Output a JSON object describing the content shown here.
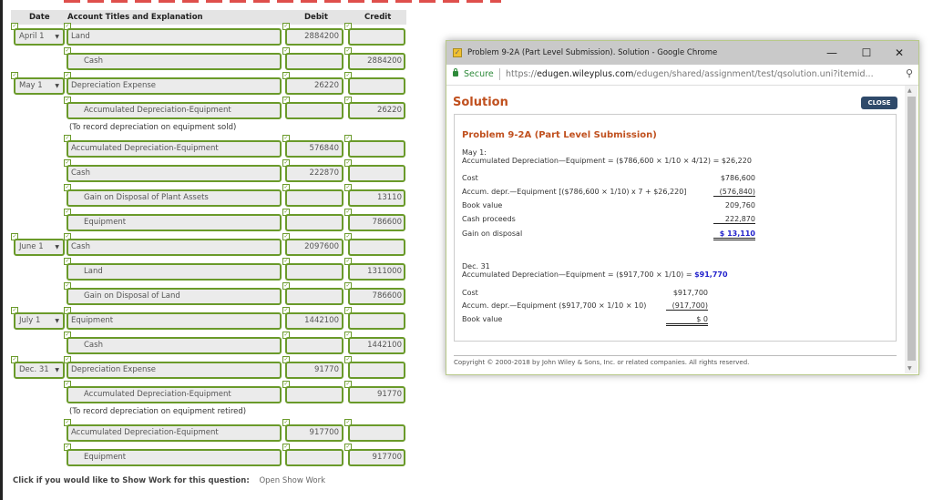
{
  "journal": {
    "headers": {
      "date": "Date",
      "account": "Account Titles and Explanation",
      "debit": "Debit",
      "credit": "Credit"
    },
    "rows": [
      {
        "date": "April 1",
        "account": "Land",
        "indent": false,
        "debit": "2884200",
        "credit": ""
      },
      {
        "date": "",
        "account": "Cash",
        "indent": true,
        "debit": "",
        "credit": "2884200"
      },
      {
        "date": "May 1",
        "account": "Depreciation Expense",
        "indent": false,
        "debit": "26220",
        "credit": ""
      },
      {
        "date": "",
        "account": "Accumulated Depreciation-Equipment",
        "indent": true,
        "debit": "",
        "credit": "26220"
      },
      {
        "explanation": "(To record depreciation on equipment sold)"
      },
      {
        "date": "",
        "account": "Accumulated Depreciation-Equipment",
        "indent": false,
        "debit": "576840",
        "credit": ""
      },
      {
        "date": "",
        "account": "Cash",
        "indent": false,
        "debit": "222870",
        "credit": ""
      },
      {
        "date": "",
        "account": "Gain on Disposal of Plant Assets",
        "indent": true,
        "debit": "",
        "credit": "13110"
      },
      {
        "date": "",
        "account": "Equipment",
        "indent": true,
        "debit": "",
        "credit": "786600"
      },
      {
        "date": "June 1",
        "account": "Cash",
        "indent": false,
        "debit": "2097600",
        "credit": ""
      },
      {
        "date": "",
        "account": "Land",
        "indent": true,
        "debit": "",
        "credit": "1311000"
      },
      {
        "date": "",
        "account": "Gain on Disposal of Land",
        "indent": true,
        "debit": "",
        "credit": "786600"
      },
      {
        "date": "July 1",
        "account": "Equipment",
        "indent": false,
        "debit": "1442100",
        "credit": ""
      },
      {
        "date": "",
        "account": "Cash",
        "indent": true,
        "debit": "",
        "credit": "1442100"
      },
      {
        "date": "Dec. 31",
        "account": "Depreciation Expense",
        "indent": false,
        "debit": "91770",
        "credit": ""
      },
      {
        "date": "",
        "account": "Accumulated Depreciation-Equipment",
        "indent": true,
        "debit": "",
        "credit": "91770"
      },
      {
        "explanation": "(To record depreciation on equipment retired)"
      },
      {
        "date": "",
        "account": "Accumulated Depreciation-Equipment",
        "indent": false,
        "debit": "917700",
        "credit": ""
      },
      {
        "date": "",
        "account": "Equipment",
        "indent": true,
        "debit": "",
        "credit": "917700"
      }
    ],
    "check_glyph": "✓",
    "dropdown_glyph": "▼"
  },
  "show_work": {
    "prompt": "Click if you would like to Show Work for this question:",
    "link": "Open Show Work"
  },
  "popup": {
    "window_title": "Problem 9-2A (Part Level Submission). Solution - Google Chrome",
    "controls": {
      "minimize": "—",
      "maximize": "☐",
      "close": "✕"
    },
    "address_bar": {
      "secure_label": "Secure",
      "url_scheme": "https://",
      "url_domain": "edugen.wileyplus.com",
      "url_path": "/edugen/shared/assignment/test/qsolution.uni?itemid...",
      "zoom_icon": "⚲"
    },
    "heading": "Solution",
    "close_label": "CLOSE",
    "problem_title": "Problem 9-2A (Part Level Submission)",
    "may1": {
      "label": "May 1:",
      "formula": "Accumulated Depreciation—Equipment = ($786,600 × 1/10 × 4/12) = $26,220",
      "lines": [
        {
          "label": "Cost",
          "value": "$786,600"
        },
        {
          "label": "Accum. depr.—Equipment [($786,600 × 1/10) x 7 + $26,220]",
          "value": "(576,840)"
        },
        {
          "label": "Book value",
          "value": "209,760"
        },
        {
          "label": "Cash proceeds",
          "value": "222,870"
        },
        {
          "label": "Gain on disposal",
          "value": "$ 13,110"
        }
      ]
    },
    "dec31": {
      "label": "Dec. 31",
      "formula_prefix": "Accumulated Depreciation—Equipment = ($917,700 × 1/10) = ",
      "formula_result": "$91,770",
      "lines": [
        {
          "label": "Cost",
          "value": "$917,700"
        },
        {
          "label": "Accum. depr.—Equipment ($917,700 × 1/10 × 10)",
          "value": "(917,700)"
        },
        {
          "label": "Book value",
          "value": "$ 0"
        }
      ]
    },
    "copyright": "Copyright © 2000-2018 by John Wiley & Sons, Inc. or related companies. All rights reserved.",
    "scroll_up": "▲",
    "scroll_down": "▼"
  }
}
